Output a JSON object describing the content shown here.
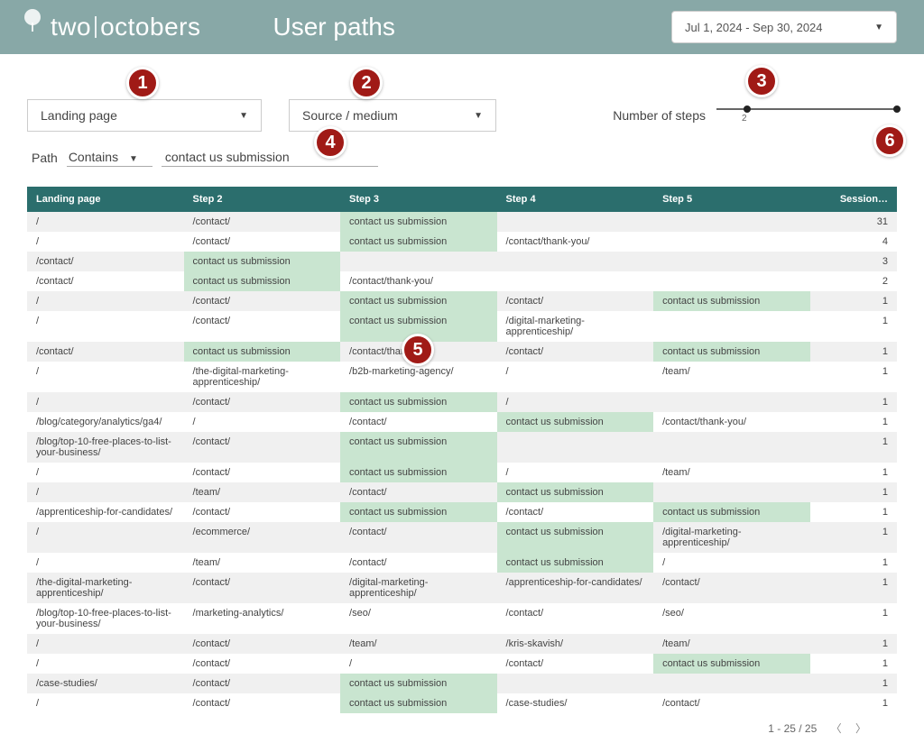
{
  "header": {
    "logo_text_a": "two",
    "logo_text_b": "octobers",
    "title": "User paths",
    "date_range": "Jul 1, 2024 - Sep 30, 2024"
  },
  "controls": {
    "dimension1": "Landing page",
    "dimension2": "Source / medium",
    "slider_label": "Number of steps",
    "slider_min_tick": "2"
  },
  "filter": {
    "label": "Path",
    "operator": "Contains",
    "value": "contact us submission"
  },
  "columns": [
    "Landing page",
    "Step 2",
    "Step 3",
    "Step 4",
    "Step 5",
    "Session…"
  ],
  "highlight_value": "contact us submission",
  "rows": [
    {
      "c": [
        "/",
        "/contact/",
        "contact us submission",
        "",
        ""
      ],
      "s": 31
    },
    {
      "c": [
        "/",
        "/contact/",
        "contact us submission",
        "/contact/thank-you/",
        ""
      ],
      "s": 4
    },
    {
      "c": [
        "/contact/",
        "contact us submission",
        "",
        "",
        ""
      ],
      "s": 3
    },
    {
      "c": [
        "/contact/",
        "contact us submission",
        "/contact/thank-you/",
        "",
        ""
      ],
      "s": 2
    },
    {
      "c": [
        "/",
        "/contact/",
        "contact us submission",
        "/contact/",
        "contact us submission"
      ],
      "s": 1
    },
    {
      "c": [
        "/",
        "/contact/",
        "contact us submission",
        "/digital-marketing-apprenticeship/",
        ""
      ],
      "s": 1
    },
    {
      "c": [
        "/contact/",
        "contact us submission",
        "/contact/thank-you/",
        "/contact/",
        "contact us submission"
      ],
      "s": 1
    },
    {
      "c": [
        "/",
        "/the-digital-marketing-apprenticeship/",
        "/b2b-marketing-agency/",
        "/",
        "/team/"
      ],
      "s": 1
    },
    {
      "c": [
        "/",
        "/contact/",
        "contact us submission",
        "/",
        ""
      ],
      "s": 1
    },
    {
      "c": [
        "/blog/category/analytics/ga4/",
        "/",
        "/contact/",
        "contact us submission",
        "/contact/thank-you/"
      ],
      "s": 1
    },
    {
      "c": [
        "/blog/top-10-free-places-to-list-your-business/",
        "/contact/",
        "contact us submission",
        "",
        ""
      ],
      "s": 1
    },
    {
      "c": [
        "/",
        "/contact/",
        "contact us submission",
        "/",
        "/team/"
      ],
      "s": 1
    },
    {
      "c": [
        "/",
        "/team/",
        "/contact/",
        "contact us submission",
        ""
      ],
      "s": 1
    },
    {
      "c": [
        "/apprenticeship-for-candidates/",
        "/contact/",
        "contact us submission",
        "/contact/",
        "contact us submission"
      ],
      "s": 1
    },
    {
      "c": [
        "/",
        "/ecommerce/",
        "/contact/",
        "contact us submission",
        "/digital-marketing-apprenticeship/"
      ],
      "s": 1
    },
    {
      "c": [
        "/",
        "/team/",
        "/contact/",
        "contact us submission",
        "/"
      ],
      "s": 1
    },
    {
      "c": [
        "/the-digital-marketing-apprenticeship/",
        "/contact/",
        "/digital-marketing-apprenticeship/",
        "/apprenticeship-for-candidates/",
        "/contact/"
      ],
      "s": 1
    },
    {
      "c": [
        "/blog/top-10-free-places-to-list-your-business/",
        "/marketing-analytics/",
        "/seo/",
        "/contact/",
        "/seo/"
      ],
      "s": 1
    },
    {
      "c": [
        "/",
        "/contact/",
        "/team/",
        "/kris-skavish/",
        "/team/"
      ],
      "s": 1
    },
    {
      "c": [
        "/",
        "/contact/",
        "/",
        "/contact/",
        "contact us submission"
      ],
      "s": 1
    },
    {
      "c": [
        "/case-studies/",
        "/contact/",
        "contact us submission",
        "",
        ""
      ],
      "s": 1
    },
    {
      "c": [
        "/",
        "/contact/",
        "contact us submission",
        "/case-studies/",
        "/contact/"
      ],
      "s": 1
    }
  ],
  "pager": {
    "text": "1 - 25 / 25"
  },
  "badges": [
    "1",
    "2",
    "3",
    "4",
    "5",
    "6"
  ]
}
